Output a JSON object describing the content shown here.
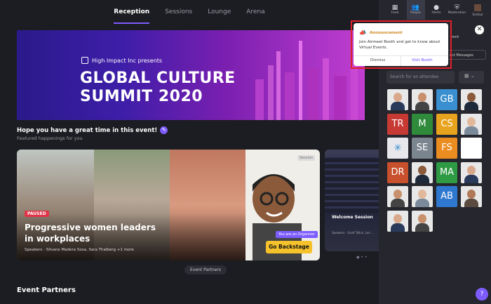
{
  "topnav": {
    "tabs": [
      {
        "label": "Reception",
        "active": true
      },
      {
        "label": "Sessions"
      },
      {
        "label": "Lounge"
      },
      {
        "label": "Arena"
      }
    ]
  },
  "banner": {
    "brand": "High Impact Inc presents",
    "title_line1": "GLOBAL CULTURE",
    "title_line2": "SUMMIT 2020"
  },
  "welcome": {
    "heading": "Hope you have a great time in this event!",
    "subheading": "Featured happenings for you"
  },
  "featured": {
    "status": "PAUSED",
    "title": "Progressive women leaders in workplaces",
    "speakers": "Speakers - Silvano Madera Sosa, Sara Thalberg +1 more",
    "session_badge": "Session",
    "organizer_badge": "You are an Organizer",
    "backstage_label": "Go Backstage"
  },
  "welcome_session": {
    "title": "Welcome Session",
    "speakers": "Speakers - Scott Tolkin, Lori ..."
  },
  "event_partners_pill": "Event Partners",
  "event_partners_heading": "Event Partners",
  "sidebar": {
    "nav": [
      {
        "label": "Feed",
        "icon": "grid-icon"
      },
      {
        "label": "People",
        "icon": "people-icon",
        "active": true
      },
      {
        "label": "Alerts",
        "icon": "alert-icon"
      },
      {
        "label": "Moderation",
        "icon": "shield-icon"
      },
      {
        "label": "Sodiya",
        "icon": "avatar"
      }
    ],
    "event_label": "vent",
    "messages_label": "ect Messages",
    "search_placeholder": "Search for an attendee",
    "attendees": [
      {
        "type": "photo"
      },
      {
        "type": "photo"
      },
      {
        "initials": "GB",
        "color": "#3a8fd0"
      },
      {
        "type": "photo"
      },
      {
        "initials": "TR",
        "color": "#c73a34"
      },
      {
        "initials": "M",
        "color": "#2f8a3c"
      },
      {
        "initials": "CS",
        "color": "#e8a31e"
      },
      {
        "type": "photo"
      },
      {
        "type": "logo"
      },
      {
        "initials": "SE",
        "color": "#7a8590"
      },
      {
        "initials": "FS",
        "color": "#ea8c20"
      },
      {
        "type": "blank"
      },
      {
        "initials": "DR",
        "color": "#c8502c"
      },
      {
        "type": "photo"
      },
      {
        "initials": "MA",
        "color": "#2f9a44"
      },
      {
        "type": "photo"
      },
      {
        "type": "photo"
      },
      {
        "type": "photo"
      },
      {
        "initials": "AB",
        "color": "#2f78d0"
      },
      {
        "type": "photo"
      },
      {
        "type": "photo"
      },
      {
        "type": "photo"
      }
    ]
  },
  "announcement": {
    "heading": "Announcement",
    "message": "Join Airmeet Booth and get to know about Virtual Events.",
    "dismiss": "Dismiss",
    "visit": "Visit Booth"
  }
}
